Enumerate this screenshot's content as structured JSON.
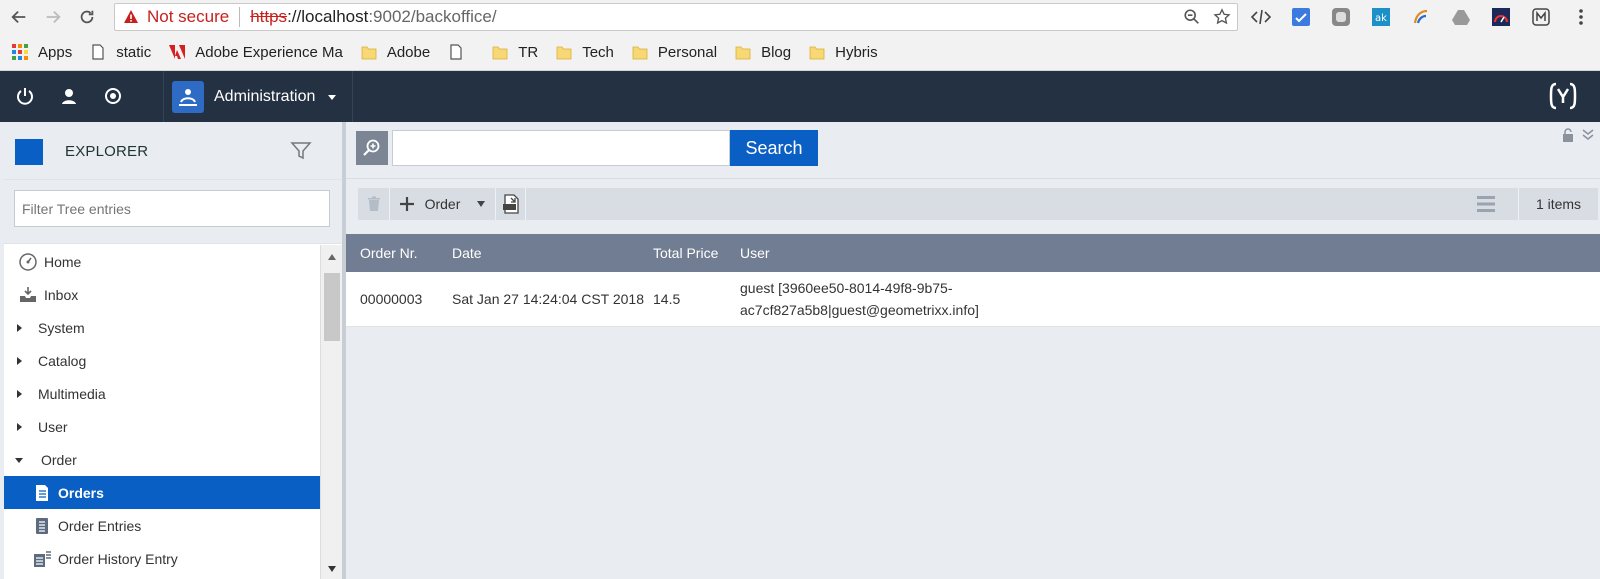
{
  "browser": {
    "not_secure_label": "Not secure",
    "url_scheme": "https",
    "url_host": "://localhost",
    "url_path": ":9002/backoffice/"
  },
  "bookmarks": [
    {
      "label": "Apps",
      "icon": "apps-grid-icon"
    },
    {
      "label": "static",
      "icon": "page-icon"
    },
    {
      "label": "Adobe Experience Ma",
      "icon": "adobe-icon"
    },
    {
      "label": "Adobe",
      "icon": "folder-icon"
    },
    {
      "label": "",
      "icon": "page-icon"
    },
    {
      "label": "TR",
      "icon": "folder-icon"
    },
    {
      "label": "Tech",
      "icon": "folder-icon"
    },
    {
      "label": "Personal",
      "icon": "folder-icon"
    },
    {
      "label": "Blog",
      "icon": "folder-icon"
    },
    {
      "label": "Hybris",
      "icon": "folder-icon"
    }
  ],
  "header": {
    "perspective_label": "Administration"
  },
  "explorer": {
    "title": "EXPLORER",
    "filter_placeholder": "Filter Tree entries",
    "items": [
      {
        "label": "Home",
        "type": "leaf"
      },
      {
        "label": "Inbox",
        "type": "leaf"
      },
      {
        "label": "System",
        "type": "collapsed"
      },
      {
        "label": "Catalog",
        "type": "collapsed"
      },
      {
        "label": "Multimedia",
        "type": "collapsed"
      },
      {
        "label": "User",
        "type": "collapsed"
      },
      {
        "label": "Order",
        "type": "expanded"
      },
      {
        "label": "Orders",
        "type": "child-selected"
      },
      {
        "label": "Order Entries",
        "type": "child"
      },
      {
        "label": "Order History Entry",
        "type": "child"
      }
    ]
  },
  "main": {
    "search_button": "Search",
    "toolbar": {
      "order_label": "Order",
      "count_label": "1 items"
    },
    "grid": {
      "columns": [
        "Order Nr.",
        "Date",
        "Total Price",
        "User"
      ],
      "rows": [
        {
          "order_nr": "00000003",
          "date": "Sat Jan 27 14:24:04 CST 2018",
          "total_price": "14.5",
          "user_line1": "guest [3960ee50-8014-49f8-9b75-",
          "user_line2": "ac7cf827a5b8|guest@geometrixx.info]"
        }
      ]
    }
  },
  "colors": {
    "header_bg": "#243143",
    "accent": "#0a5fc4",
    "grid_header": "#717d92"
  }
}
